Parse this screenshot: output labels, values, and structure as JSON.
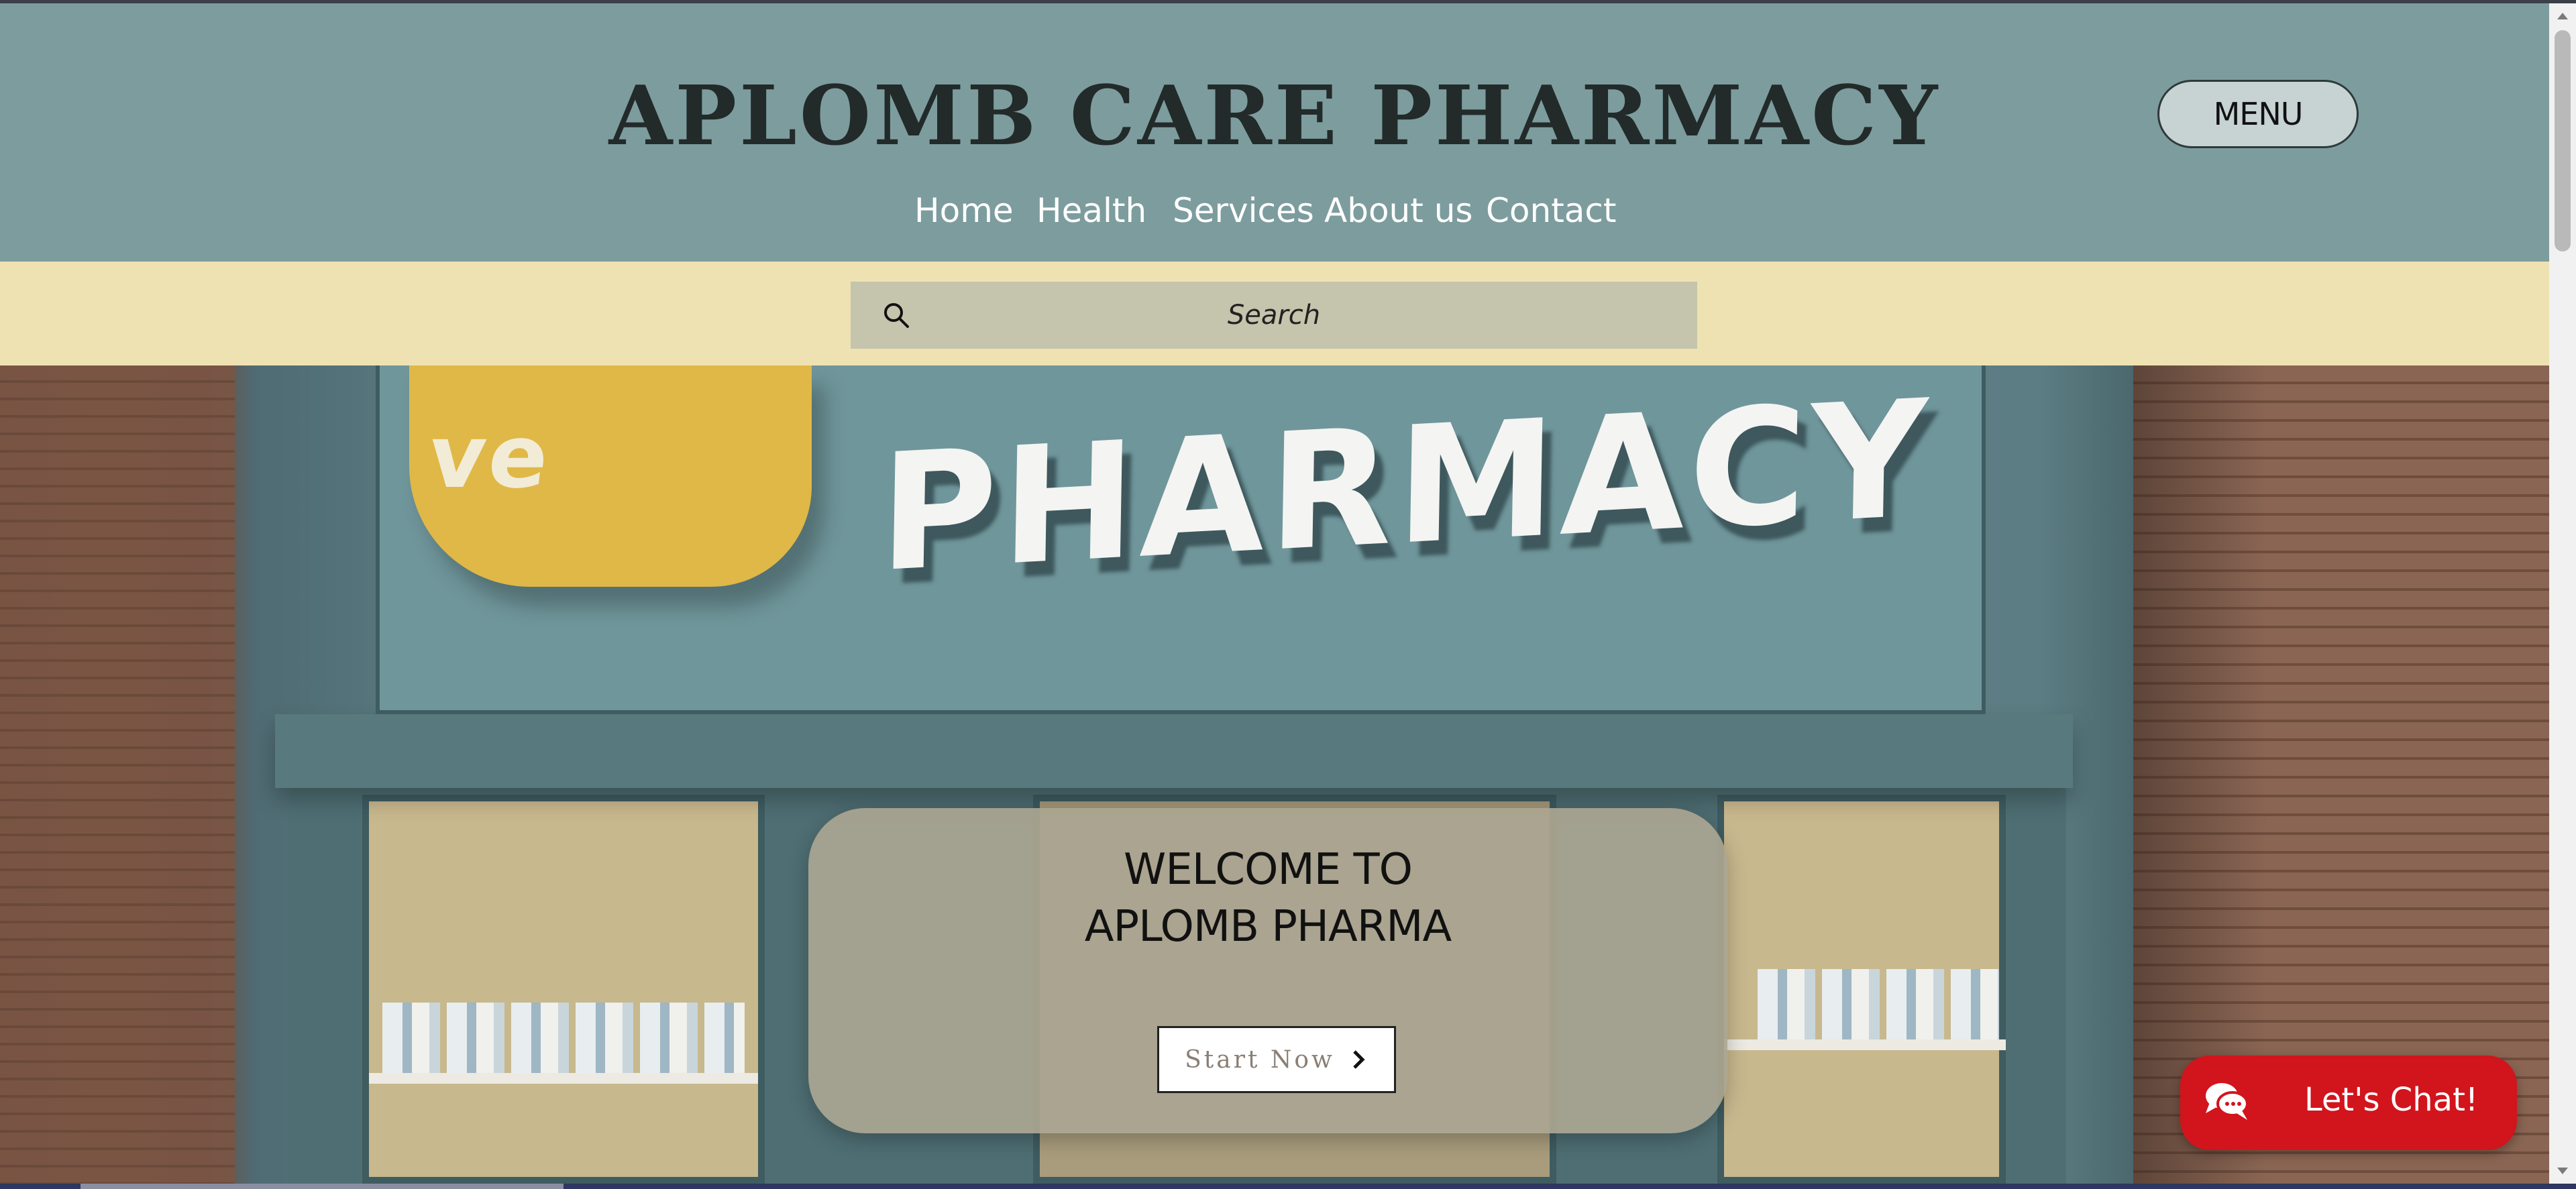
{
  "header": {
    "site_title": "APLOMB CARE PHARMACY",
    "menu_label": "MENU",
    "nav": [
      {
        "label": "Home"
      },
      {
        "label": "Health"
      },
      {
        "label": "Services"
      },
      {
        "label": "About us"
      },
      {
        "label": "Contact"
      }
    ]
  },
  "search": {
    "placeholder": "Search"
  },
  "hero": {
    "sign_logo_text": "ve",
    "sign_text": "PHARMACY",
    "welcome_line1": "WELCOME TO",
    "welcome_line2": "APLOMB PHARMA",
    "cta_label": "Start Now"
  },
  "chat": {
    "label": "Let's Chat!"
  },
  "colors": {
    "header_bg": "#7d9c9e",
    "search_strip_bg": "#efe2b2",
    "search_box_bg": "#c5c4ac",
    "chat_bg": "#d2141c"
  },
  "icons": {
    "search": "search-icon",
    "chevron": "chevron-right-icon",
    "chat": "chat-bubble-icon"
  }
}
